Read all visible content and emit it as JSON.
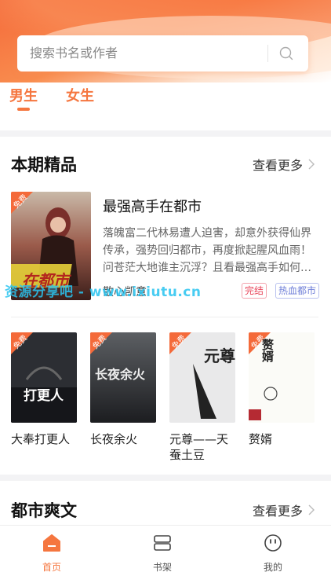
{
  "search": {
    "placeholder": "搜索书名或作者",
    "icon": "search-icon"
  },
  "gender_tabs": [
    {
      "label": "男生",
      "active": true
    },
    {
      "label": "女生",
      "active": false
    }
  ],
  "section1": {
    "title": "本期精品",
    "more": "查看更多",
    "featured": {
      "title": "最强高手在都市",
      "description": "落魄富二代林易遭人迫害，却意外获得仙界传承，强势回归都市，再度掀起腥风血雨！问苍茫大地谁主沉浮？且看最强高手如何…",
      "author": "散心凯意",
      "tags": [
        "完结",
        "热血都市"
      ],
      "badge": "免费",
      "cover_text": "在都市"
    },
    "books": [
      {
        "name": "大奉打更人",
        "badge": "免费",
        "cover_text": "打更人"
      },
      {
        "name": "长夜余火",
        "badge": "免费",
        "cover_text": "长夜余火"
      },
      {
        "name": "元尊——天蚕土豆",
        "badge": "免费",
        "cover_text": "元尊"
      },
      {
        "name": "赘婿",
        "badge": "免费",
        "cover_text": "赘婿"
      }
    ]
  },
  "section2": {
    "title": "都市爽文",
    "more": "查看更多"
  },
  "watermark": "资源分享吧 - www.ixiutu.cn",
  "tabbar": [
    {
      "label": "首页",
      "icon": "home-icon",
      "active": true
    },
    {
      "label": "书架",
      "icon": "bookshelf-icon",
      "active": false
    },
    {
      "label": "我的",
      "icon": "profile-icon",
      "active": false
    }
  ],
  "colors": {
    "accent": "#f5763f",
    "tag_finished": "#e8455a",
    "tag_genre": "#6f7fd8"
  }
}
